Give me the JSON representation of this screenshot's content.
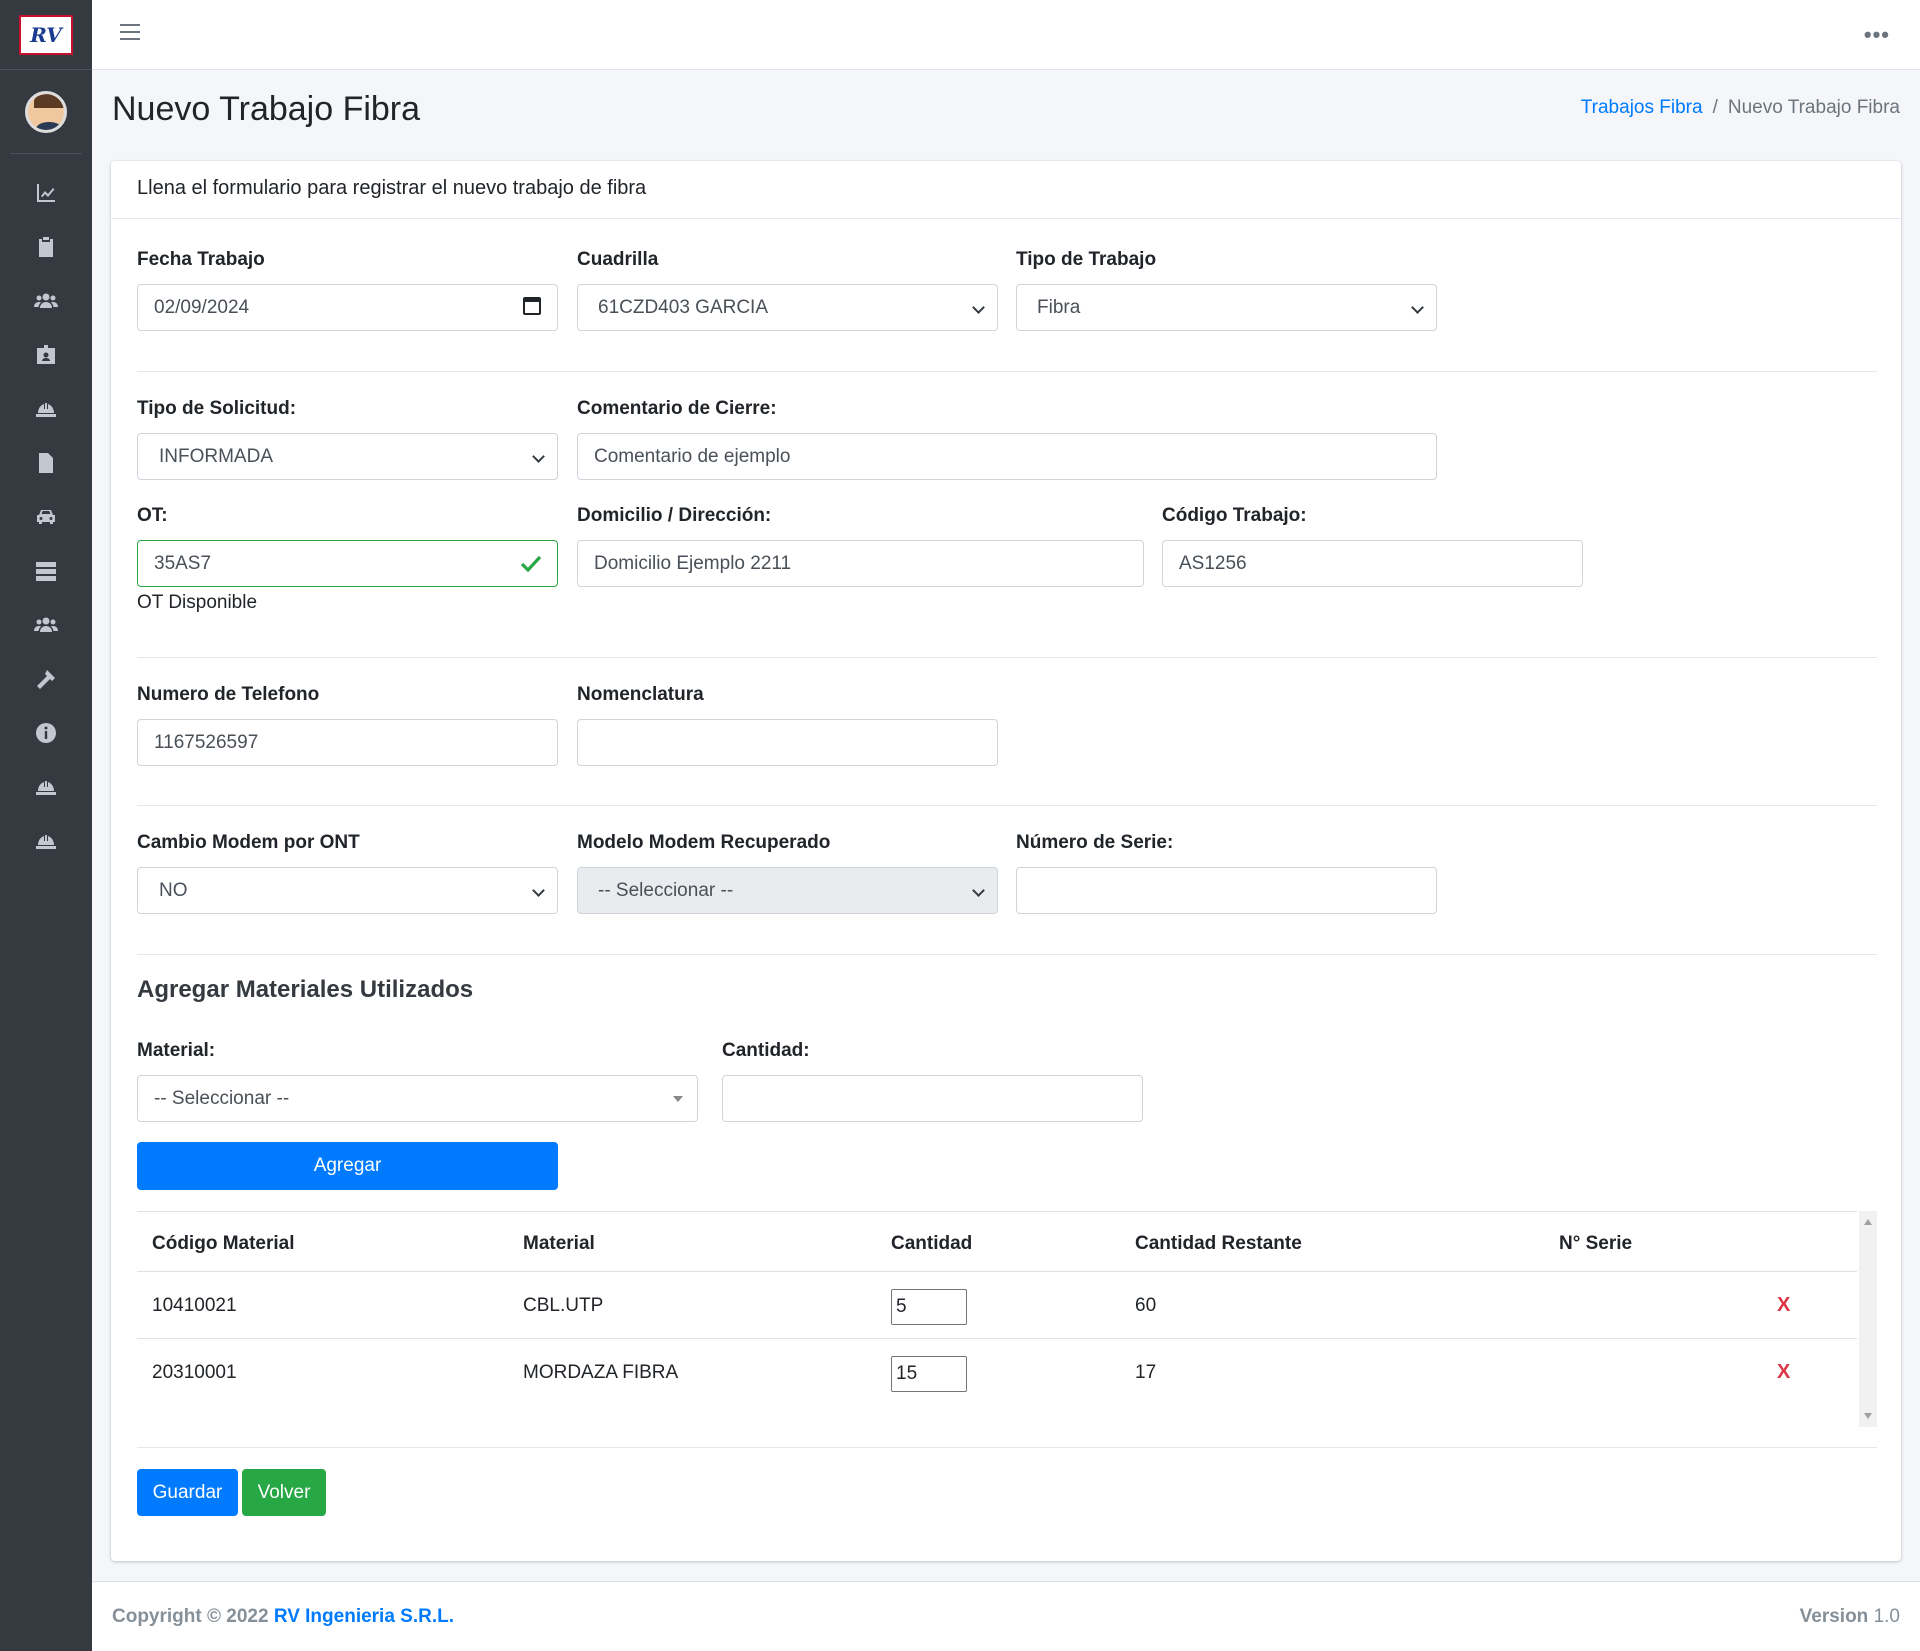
{
  "sidebar": {
    "logo_text": "RV",
    "icons": [
      "chart-line-icon",
      "clipboard-icon",
      "users-icon",
      "id-badge-icon",
      "hard-hat-icon",
      "file-icon",
      "car-icon",
      "server-icon",
      "users-group-icon",
      "hammer-icon",
      "info-circle-icon",
      "hard-hat-icon",
      "hard-hat-icon"
    ]
  },
  "header": {
    "page_title": "Nuevo Trabajo Fibra",
    "breadcrumb": {
      "parent": "Trabajos Fibra",
      "sep": "/",
      "current": "Nuevo Trabajo Fibra"
    }
  },
  "card": {
    "header_text": "Llena el formulario para registrar el nuevo trabajo de fibra"
  },
  "form": {
    "fecha_label": "Fecha Trabajo",
    "fecha_value": "02/09/2024",
    "cuadrilla_label": "Cuadrilla",
    "cuadrilla_value": "61CZD403 GARCIA",
    "tipo_trabajo_label": "Tipo de Trabajo",
    "tipo_trabajo_value": "Fibra",
    "tipo_solicitud_label": "Tipo de Solicitud:",
    "tipo_solicitud_value": "INFORMADA",
    "comentario_label": "Comentario de Cierre:",
    "comentario_value": "Comentario de ejemplo",
    "ot_label": "OT:",
    "ot_value": "35AS7",
    "ot_status": "OT Disponible",
    "domicilio_label": "Domicilio / Dirección:",
    "domicilio_value": "Domicilio Ejemplo 2211",
    "codigo_label": "Código Trabajo:",
    "codigo_value": "AS1256",
    "telefono_label": "Numero de Telefono",
    "telefono_value": "1167526597",
    "nomenclatura_label": "Nomenclatura",
    "nomenclatura_value": "",
    "cambio_modem_label": "Cambio Modem por ONT",
    "cambio_modem_value": "NO",
    "modelo_modem_label": "Modelo Modem Recuperado",
    "modelo_modem_value": "-- Seleccionar --",
    "numero_serie_label": "Número de Serie:",
    "numero_serie_value": ""
  },
  "materiales": {
    "title": "Agregar Materiales Utilizados",
    "material_label": "Material:",
    "material_value": "-- Seleccionar --",
    "cantidad_label": "Cantidad:",
    "cantidad_value": "",
    "agregar_label": "Agregar",
    "columns": [
      "Código Material",
      "Material",
      "Cantidad",
      "Cantidad Restante",
      "N° Serie"
    ],
    "rows": [
      {
        "codigo": "10410021",
        "material": "CBL.UTP",
        "cantidad": "5",
        "restante": "60",
        "serie": "",
        "delete": "X"
      },
      {
        "codigo": "20310001",
        "material": "MORDAZA FIBRA",
        "cantidad": "15",
        "restante": "17",
        "serie": "",
        "delete": "X"
      }
    ]
  },
  "actions": {
    "guardar_label": "Guardar",
    "volver_label": "Volver"
  },
  "footer": {
    "copyright": "Copyright © 2022 ",
    "company": "RV Ingenieria S.R.L.",
    "version_label": "Version",
    "version_value": "1.0"
  },
  "colors": {
    "primary": "#007bff",
    "success": "#28a745",
    "danger": "#dc3545",
    "sidebar_bg": "#343a40"
  }
}
